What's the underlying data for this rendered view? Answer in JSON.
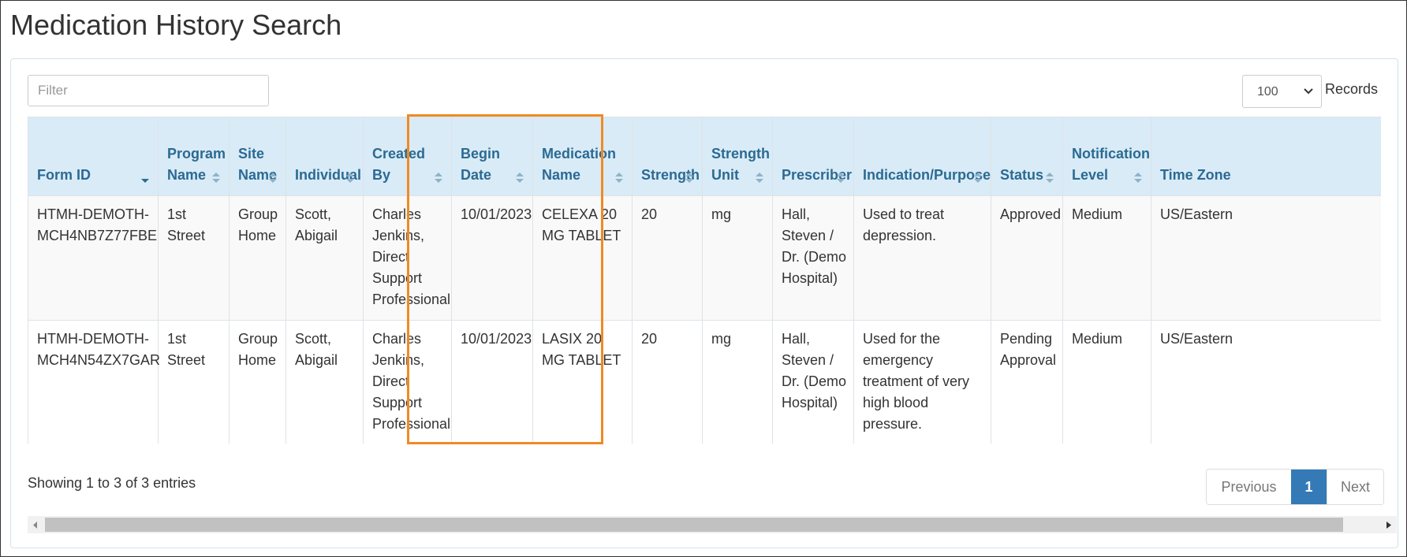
{
  "page_title": "Medication History Search",
  "filter": {
    "placeholder": "Filter",
    "value": ""
  },
  "records": {
    "selected": "100",
    "label": "Records"
  },
  "columns": [
    "Form ID",
    "Program Name",
    "Site Name",
    "Individual",
    "Created By",
    "Begin Date",
    "Medication Name",
    "Strength",
    "Strength Unit",
    "Prescriber",
    "Indication/Purpose",
    "Status",
    "Notification Level",
    "Time Zone"
  ],
  "rows": [
    {
      "form_id": "HTMH-DEMOTH-MCH4NB7Z77FBE",
      "program_name": "1st Street",
      "site_name": "Group Home",
      "individual": "Scott, Abigail",
      "created_by": "Charles Jenkins, Direct Support Professional",
      "begin_date": "10/01/2023",
      "medication_name": "CELEXA 20 MG TABLET",
      "strength": "20",
      "strength_unit": "mg",
      "prescriber": "Hall, Steven / Dr. (Demo Hospital)",
      "indication": "Used to treat depression.",
      "status": "Approved",
      "notification_level": "Medium",
      "time_zone": "US/Eastern"
    },
    {
      "form_id": "HTMH-DEMOTH-MCH4N54ZX7GAR",
      "program_name": "1st Street",
      "site_name": "Group Home",
      "individual": "Scott, Abigail",
      "created_by": "Charles Jenkins, Direct Support Professional",
      "begin_date": "10/01/2023",
      "medication_name": "LASIX 20 MG TABLET",
      "strength": "20",
      "strength_unit": "mg",
      "prescriber": "Hall, Steven / Dr. (Demo Hospital)",
      "indication": "Used for the emergency treatment of very high blood pressure.",
      "status": "Pending Approval",
      "notification_level": "Medium",
      "time_zone": "US/Eastern"
    }
  ],
  "info_text": "Showing 1 to 3 of 3 entries",
  "pagination": {
    "previous": "Previous",
    "current": "1",
    "next": "Next"
  },
  "colors": {
    "header_bg": "#d9ebf6",
    "header_text": "#2b6a93",
    "highlight": "#f08a24",
    "active_page": "#337ab7"
  }
}
